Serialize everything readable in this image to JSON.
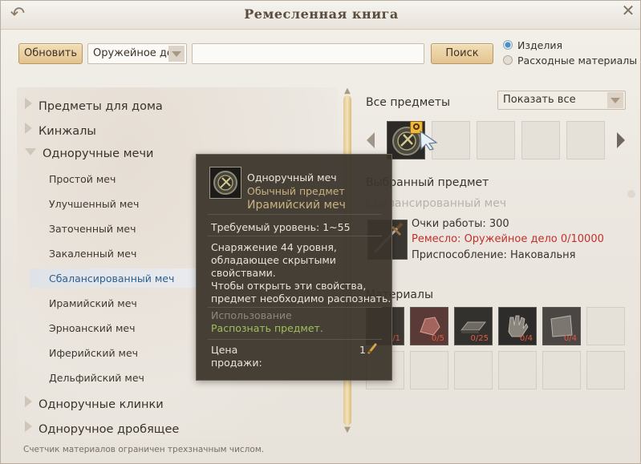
{
  "window": {
    "title": "Ремесленная книга"
  },
  "toolbar": {
    "refresh_label": "Обновить",
    "category_select": "Оружейное де..",
    "search_value": "",
    "search_label": "Поиск",
    "radio_products": "Изделия",
    "radio_consumables": "Расходные материалы"
  },
  "categories": {
    "home": "Предметы для дома",
    "daggers": "Кинжалы",
    "one_hand_swords": "Одноручные мечи",
    "one_hand_blades": "Одноручные клинки",
    "one_hand_blunt": "Одноручное дробящее"
  },
  "subitems": [
    "Простой меч",
    "Улучшенный меч",
    "Заточенный меч",
    "Закаленный меч",
    "Сбалансированный меч",
    "Ирамийский меч",
    "Эрноанский меч",
    "Иферийский меч",
    "Дельфийский меч"
  ],
  "right": {
    "all_items": "Все предметы",
    "show_all": "Показать все",
    "selected_item": "Выбранный предмет",
    "selected_name": "Сбалансированный меч",
    "work_points": "Очки работы: 300",
    "craft": "Ремесло: Оружейное дело 0/10000",
    "tool": "Приспособление: Наковальня",
    "materials": "Материалы",
    "material_counts": [
      "1/1",
      "0/5",
      "0/25",
      "0/4",
      "0/4"
    ]
  },
  "tooltip": {
    "type": "Одноручный меч",
    "grade": "Обычный предмет",
    "name": "Ирамийский меч",
    "level": "Требуемый уровень: 1~55",
    "desc1": "Снаряжение 44 уровня,",
    "desc2": "обладающее скрытыми",
    "desc3": "свойствами.",
    "desc4": "Чтобы открыть эти свойства,",
    "desc5": "предмет необходимо распознать.",
    "usage_label": "Использование",
    "usage_action": "Распознать предмет.",
    "price_label1": "Цена",
    "price_label2": "продажи:",
    "price_value": "1"
  },
  "footer": {
    "note": "Счетчик материалов ограничен трехзначным числом."
  },
  "colors": {
    "accent_button": "#e3c38e",
    "selected_text": "#2d5f8e",
    "warning_red": "#c0312b",
    "tooltip_grade": "#c9b27f",
    "tooltip_usage": "#9fc05a"
  }
}
